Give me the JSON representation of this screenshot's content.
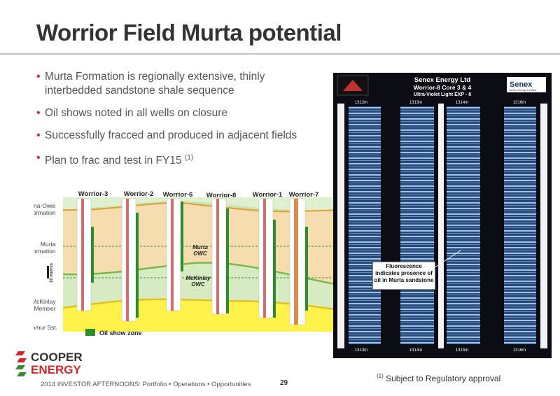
{
  "slide": {
    "title": "Worrior Field Murta potential",
    "bullets": [
      "Murta Formation is regionally extensive, thinly interbedded sandstone shale sequence",
      "Oil shows noted in all wells on closure",
      "Successfully fracced and produced in adjacent fields",
      "Plan to frac and test in FY15"
    ],
    "bullet4_ref": "(1)",
    "footer": "2014 INVESTOR AFTERNOONS: Portfolio • Operations • Opportunities",
    "page_number": "29",
    "footnote_ref": "(1)",
    "footnote_text": "Subject to Regulatory approval"
  },
  "logo": {
    "line1": "COOPER",
    "line2": "ENERGY"
  },
  "cross_section": {
    "wells": [
      "Worrior-3",
      "Worrior-2",
      "Worrior-6",
      "Worrior-8",
      "Worrior-1",
      "Worrior-7"
    ],
    "formations": [
      "Cadna-Owie Formation",
      "Murta Formation",
      "McKinlay Member",
      "Namur Sst."
    ],
    "formation_lines": [
      [
        "Cadna-Owie",
        "Formation"
      ],
      [
        "Murta",
        "Formation"
      ],
      [
        "McKinlay",
        "Member"
      ],
      [
        "Namur Sst."
      ]
    ],
    "scale_label": "10 metres",
    "murta_owc": [
      "Murta",
      "OWC"
    ],
    "mckinlay_owc": [
      "McKinlay",
      "OWC"
    ],
    "legend_label": "Oil show zone",
    "colors": {
      "oil_show": "#2e8b2e",
      "murta": "#f5ddb0",
      "namur": "#fff24a"
    }
  },
  "core_photo": {
    "company": "Senex Energy Ltd",
    "subtitle": "Worrior-8   Core 3 & 4",
    "light": "Ultra-Violet Light    EXP - 8",
    "logo_text": "Senex",
    "logo_sub": "Senex Energy Limited",
    "top_depths": [
      "1312m",
      "1313m",
      "1314m",
      "1316m"
    ],
    "bottom_depths": [
      "1313m",
      "1314m",
      "1315m",
      "1316m"
    ],
    "callout": "Fluorescence indicates presence of oil in Murta sandstone"
  }
}
